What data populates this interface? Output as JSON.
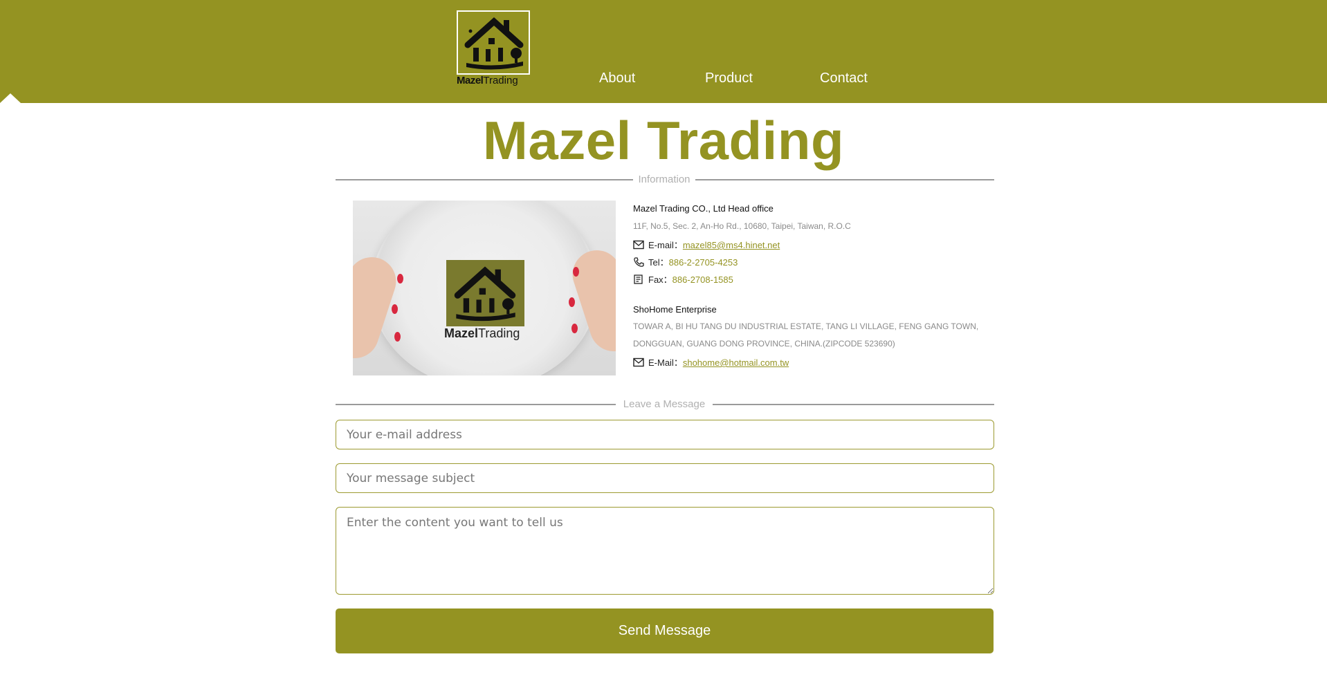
{
  "header": {
    "logo_brand_bold": "Mazel",
    "logo_brand_rest": "Trading",
    "nav": [
      {
        "label": "About"
      },
      {
        "label": "Product"
      },
      {
        "label": "Contact"
      }
    ]
  },
  "title": {
    "part1": "Mazel",
    "part2": "Trading"
  },
  "info": {
    "section_label": "Information",
    "image_logo_bold": "Mazel",
    "image_logo_rest": "Trading",
    "head_office": {
      "name": "Mazel Trading CO., Ltd Head office",
      "address": "11F, No.5, Sec. 2, An-Ho Rd., 10680, Taipei, Taiwan, R.O.C",
      "email_label": "E-mail：",
      "email": "mazel85@ms4.hinet.net",
      "tel_label": "Tel：",
      "tel": "886-2-2705-4253",
      "fax_label": "Fax：",
      "fax": "886-2708-1585"
    },
    "enterprise": {
      "name": "ShoHome Enterprise",
      "address_line1": "TOWAR A, BI HU TANG DU INDUSTRIAL ESTATE, TANG LI VILLAGE, FENG GANG TOWN,",
      "address_line2": "DONGGUAN, GUANG DONG PROVINCE, CHINA.(ZIPCODE 523690)",
      "email_label": "E-Mail：",
      "email": "shohome@hotmail.com.tw"
    }
  },
  "form": {
    "section_label": "Leave a Message",
    "email_placeholder": "Your e-mail address",
    "subject_placeholder": "Your message subject",
    "content_placeholder": "Enter the content you want to tell us",
    "send_label": "Send Message"
  },
  "colors": {
    "brand": "#949322",
    "border": "#9c9a30",
    "muted": "#8a8a8a"
  }
}
